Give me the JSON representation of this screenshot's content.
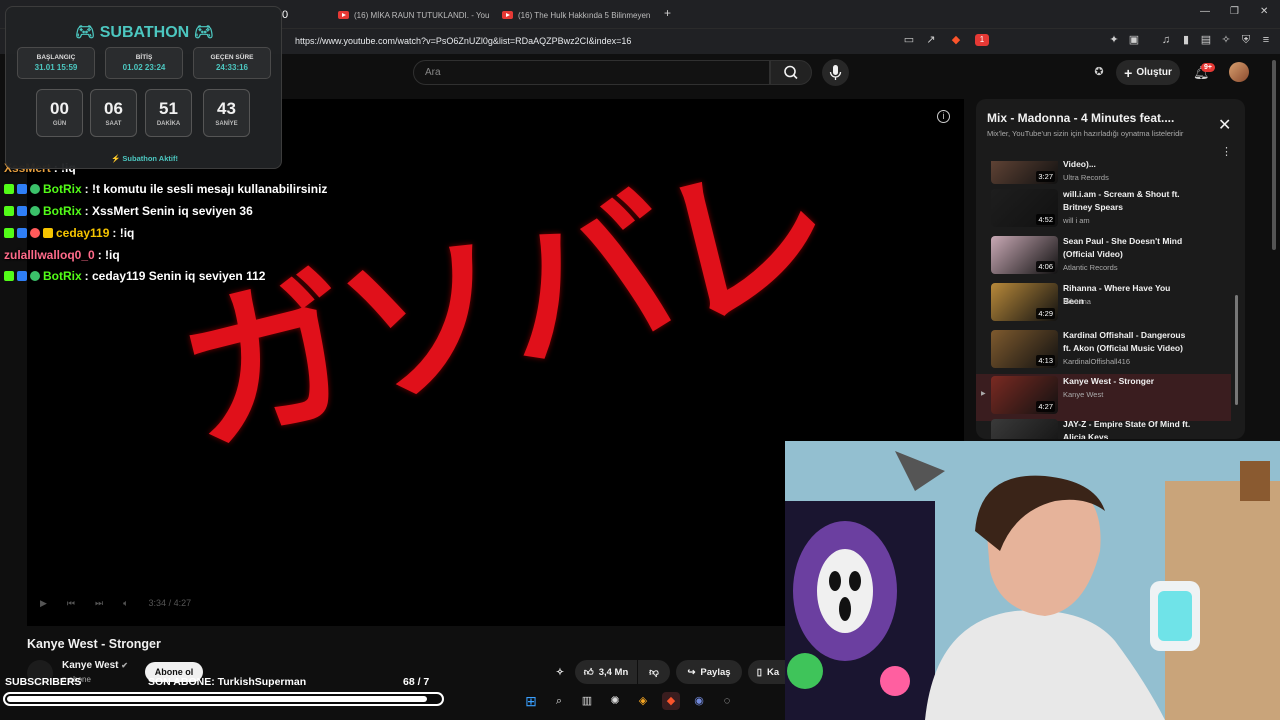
{
  "browser": {
    "tabs": [
      {
        "label": "0"
      },
      {
        "label": "(16) MİKA RAUN TUTUKLANDI. - You"
      },
      {
        "label": "(16) The Hulk Hakkında 5 Bilinmeyen"
      }
    ],
    "url": "https://www.youtube.com/watch?v=PsO6ZnUZl0g&list=RDaAQZPBwz2CI&index=16",
    "extension_badge": "1"
  },
  "youtube": {
    "search_placeholder": "Ara",
    "create_label": "Oluştur",
    "notif_count": "9+"
  },
  "player": {
    "overlay_text": "ガソバレ",
    "time_label": "3:34 / 4:27"
  },
  "video": {
    "title": "Kanye West - Stronger",
    "channel": "Kanye West",
    "subs_suffix": "n abone",
    "subscribe_label": "Abone ol",
    "likes": "3,4 Mn",
    "share_label": "Paylaş",
    "save_label": "Ka"
  },
  "playlist": {
    "title": "Mix - Madonna - 4 Minutes feat....",
    "subtitle": "Mix'ler, YouTube'un sizin için hazırladığı oynatma listeleridir",
    "items": [
      {
        "title": "Guru Josh Project (Official Video)...",
        "channel": "Ultra Records",
        "duration": "3:27",
        "active": false,
        "thumb": "#6b4a3a"
      },
      {
        "title": "will.i.am - Scream & Shout ft. Britney Spears",
        "channel": "will i am",
        "duration": "4:52",
        "active": false,
        "thumb": "#1e1e1e"
      },
      {
        "title": "Sean Paul - She Doesn't Mind (Official Video)",
        "channel": "Atlantic Records",
        "duration": "4:06",
        "active": false,
        "thumb": "#c9a9b5"
      },
      {
        "title": "Rihanna - Where Have You Been",
        "channel": "Rihanna",
        "duration": "4:29",
        "active": false,
        "thumb": "#b8893a"
      },
      {
        "title": "Kardinal Offishall - Dangerous ft. Akon (Official Music Video)",
        "channel": "KardinalOffishall416",
        "duration": "4:13",
        "active": false,
        "thumb": "#7e5a2e"
      },
      {
        "title": "Kanye West - Stronger",
        "channel": "Kanye West",
        "duration": "4:27",
        "active": true,
        "thumb": "#7a2a22"
      },
      {
        "title": "JAY-Z - Empire State Of Mind ft. Alicia Keys",
        "channel": "",
        "duration": "",
        "active": false,
        "thumb": "#3a3a3a"
      }
    ]
  },
  "subathon": {
    "title": "SUBATHON",
    "start_label": "BAŞLANGIÇ",
    "start_value": "31.01 15:59",
    "end_label": "BİTİŞ",
    "end_value": "01.02 23:24",
    "elapsed_label": "GEÇEN SÜRE",
    "elapsed_value": "24:33:16",
    "countdown": [
      {
        "num": "00",
        "unit": "GÜN"
      },
      {
        "num": "06",
        "unit": "SAAT"
      },
      {
        "num": "51",
        "unit": "DAKİKA"
      },
      {
        "num": "43",
        "unit": "SANİYE"
      }
    ],
    "status": "⚡ Subathon Aktif!"
  },
  "chat": [
    {
      "user": "XssMert",
      "msg": ": !iq",
      "color": "#e8a040",
      "badges": []
    },
    {
      "user": "BotRix",
      "msg": ": !t komutu ile sesli mesajı kullanabilirsiniz",
      "color": "#53fc18",
      "badges": [
        "k",
        "t",
        "v"
      ]
    },
    {
      "user": "BotRix",
      "msg": ": XssMert Senin iq seviyen 36",
      "color": "#53fc18",
      "badges": [
        "k",
        "t",
        "v"
      ]
    },
    {
      "user": "ceday119",
      "msg": ": !iq",
      "color": "#f5c400",
      "badges": [
        "k",
        "t",
        "f",
        "c"
      ]
    },
    {
      "user": "zulalllwalloq0_0",
      "msg": ": !iq",
      "color": "#ff6b8a",
      "badges": []
    },
    {
      "user": "BotRix",
      "msg": ": ceday119 Senin iq seviyen 112",
      "color": "#53fc18",
      "badges": [
        "k",
        "t",
        "v"
      ]
    }
  ],
  "stream_overlay": {
    "subscribers_label": "SUBSCRIBERS",
    "last_sub": "SON ABONE: TurkishSuperman",
    "sub_count": "68 / 7",
    "progress": 0.97
  }
}
